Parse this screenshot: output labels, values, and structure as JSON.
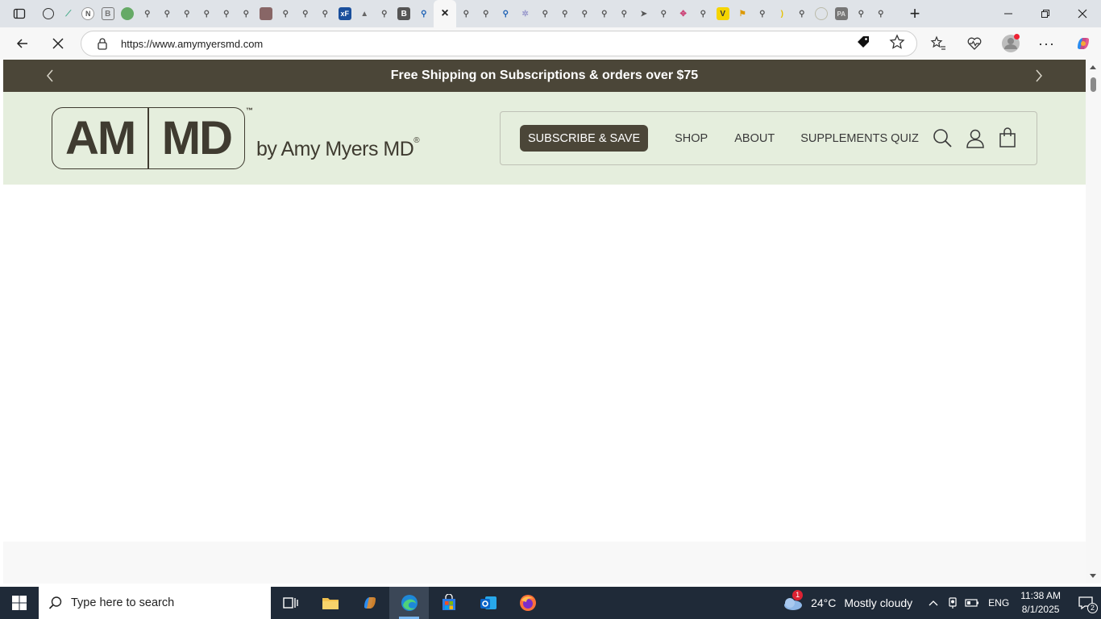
{
  "browser": {
    "tab_count_icons": [
      "openai-icon",
      "chart-icon",
      "notion-icon",
      "b-icon",
      "globe-icon",
      "search-icon",
      "search-icon",
      "search-icon",
      "search-icon",
      "search-icon",
      "search-icon",
      "castle-icon",
      "search-icon",
      "search-icon",
      "search-icon",
      "xf-icon",
      "bird-icon",
      "search-icon",
      "b-icon",
      "search-icon",
      "active-tab",
      "search-icon",
      "search-icon",
      "search-icon",
      "sparkle-icon",
      "search-icon",
      "search-icon",
      "search-icon",
      "search-icon",
      "search-icon",
      "search-icon",
      "pin-icon",
      "search-icon",
      "pink-icon",
      "search-icon",
      "v-icon",
      "flag-icon",
      "search-icon",
      "banana-icon",
      "search-icon",
      "globe-icon",
      "pa-icon",
      "search-icon",
      "search-icon"
    ],
    "active_tab_close": "×",
    "url": "https://www.amymyersmd.com"
  },
  "site": {
    "promo_text": "Free Shipping on Subscriptions & orders over $75",
    "logo_left": "AM",
    "logo_right": "MD",
    "logo_tm": "™",
    "logo_by": "by Amy Myers MD",
    "logo_reg": "®",
    "nav": {
      "subscribe": "SUBSCRIBE & SAVE",
      "shop": "SHOP",
      "about": "ABOUT",
      "quiz": "SUPPLEMENTS QUIZ"
    }
  },
  "taskbar": {
    "search_placeholder": "Type here to search",
    "weather_temp": "24°C",
    "weather_cond": "Mostly cloudy",
    "weather_badge": "1",
    "lang": "ENG",
    "time": "11:38 AM",
    "date": "8/1/2025",
    "notif_count": "2"
  },
  "colors": {
    "promo_bg": "#4b4638",
    "header_bg": "#e5eedd",
    "brand_dark": "#3f3b30",
    "taskbar_bg": "#1f2a38"
  }
}
